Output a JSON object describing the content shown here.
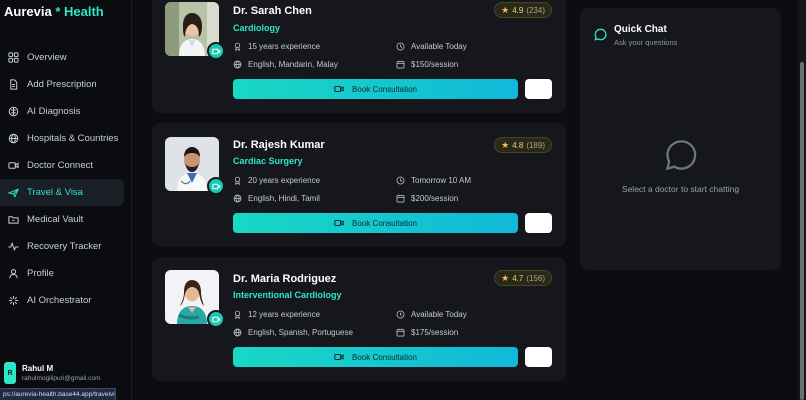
{
  "brand": {
    "name": "Aurevia",
    "sep": " * ",
    "name2": "Health"
  },
  "sidebar": {
    "items": [
      {
        "label": "Overview",
        "icon": "grid-icon"
      },
      {
        "label": "Add Prescription",
        "icon": "document-icon"
      },
      {
        "label": "AI Diagnosis",
        "icon": "brain-icon"
      },
      {
        "label": "Hospitals & Countries",
        "icon": "globe-icon"
      },
      {
        "label": "Doctor Connect",
        "icon": "video-icon"
      },
      {
        "label": "Travel & Visa",
        "icon": "plane-icon",
        "active": true
      },
      {
        "label": "Medical Vault",
        "icon": "folder-icon"
      },
      {
        "label": "Recovery Tracker",
        "icon": "activity-icon"
      },
      {
        "label": "Profile",
        "icon": "user-icon"
      },
      {
        "label": "AI Orchestrator",
        "icon": "sparkle-icon"
      }
    ]
  },
  "user": {
    "initial": "R",
    "name": "Rahul M",
    "email": "rahulmogilipuri@gmail.com"
  },
  "status_url": "ps://aurevia-health.base44.app/travelvisa",
  "doctors": [
    {
      "name": "Dr. Sarah Chen",
      "specialty": "Cardiology",
      "rating": "4.9",
      "reviews": "(234)",
      "experience": "15 years experience",
      "availability": "Available Today",
      "languages": "English, Mandarin, Malay",
      "price": "$150/session",
      "book_label": "Book Consultation"
    },
    {
      "name": "Dr. Rajesh Kumar",
      "specialty": "Cardiac Surgery",
      "rating": "4.8",
      "reviews": "(189)",
      "experience": "20 years experience",
      "availability": "Tomorrow 10 AM",
      "languages": "English, Hindi, Tamil",
      "price": "$200/session",
      "book_label": "Book Consultation"
    },
    {
      "name": "Dr. Maria Rodriguez",
      "specialty": "Interventional Cardiology",
      "rating": "4.7",
      "reviews": "(156)",
      "experience": "12 years experience",
      "availability": "Available Today",
      "languages": "English, Spanish, Portuguese",
      "price": "$175/session",
      "book_label": "Book Consultation"
    }
  ],
  "chat": {
    "title": "Quick Chat",
    "subtitle": "Ask your questions",
    "empty": "Select a doctor to start chatting"
  },
  "colors": {
    "accent": "#2ee6c8",
    "bg": "#0b0d12",
    "card": "#15171d",
    "star": "#f3c23b"
  }
}
